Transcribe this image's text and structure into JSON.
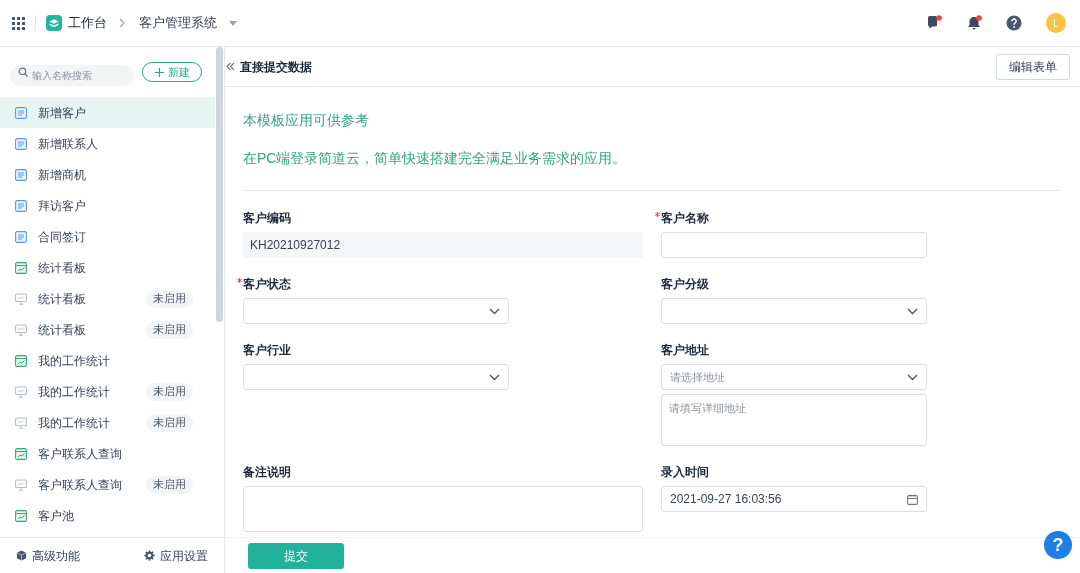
{
  "topbar": {
    "workspace": "工作台",
    "app": "客户管理系统",
    "actions": [
      {
        "kind": "chat",
        "unread": true
      },
      {
        "kind": "bell",
        "unread": true
      },
      {
        "kind": "help",
        "unread": false
      }
    ],
    "avatar": "L"
  },
  "sidebar": {
    "search": {
      "placeholder": "输入名称搜索"
    },
    "new_button": "新建",
    "items": [
      {
        "kind": "form",
        "label": "新增客户",
        "selected": true,
        "disabled": false
      },
      {
        "kind": "form",
        "label": "新增联系人",
        "selected": false,
        "disabled": false
      },
      {
        "kind": "form",
        "label": "新增商机",
        "selected": false,
        "disabled": false
      },
      {
        "kind": "form",
        "label": "拜访客户",
        "selected": false,
        "disabled": false
      },
      {
        "kind": "form",
        "label": "合同签订",
        "selected": false,
        "disabled": false
      },
      {
        "kind": "report",
        "label": "统计看板",
        "selected": false,
        "disabled": false
      },
      {
        "kind": "report",
        "label": "统计看板",
        "selected": false,
        "disabled": true,
        "badge": "未启用"
      },
      {
        "kind": "report",
        "label": "统计看板",
        "selected": false,
        "disabled": true,
        "badge": "未启用"
      },
      {
        "kind": "report",
        "label": "我的工作统计",
        "selected": false,
        "disabled": false
      },
      {
        "kind": "report",
        "label": "我的工作统计",
        "selected": false,
        "disabled": true,
        "badge": "未启用"
      },
      {
        "kind": "report",
        "label": "我的工作统计",
        "selected": false,
        "disabled": true,
        "badge": "未启用"
      },
      {
        "kind": "report",
        "label": "客户联系人查询",
        "selected": false,
        "disabled": false
      },
      {
        "kind": "report",
        "label": "客户联系人查询",
        "selected": false,
        "disabled": true,
        "badge": "未启用"
      },
      {
        "kind": "report",
        "label": "客户池",
        "selected": false,
        "disabled": false
      }
    ],
    "footer": [
      {
        "kind": "advanced",
        "label": "高级功能"
      },
      {
        "kind": "settings",
        "label": "应用设置"
      }
    ]
  },
  "main": {
    "title": "直接提交数据",
    "edit_button": "编辑表单",
    "intro": [
      "本模板应用可供参考",
      "在PC端登录简道云，简单快速搭建完全满足业务需求的应用。"
    ],
    "fields": [
      {
        "kind": "readonly",
        "label": "客户编码",
        "required": false,
        "value": "KH20210927012"
      },
      {
        "kind": "text",
        "label": "客户名称",
        "required": true
      },
      {
        "kind": "select",
        "label": "客户状态",
        "required": true
      },
      {
        "kind": "select",
        "label": "客户分级",
        "required": false
      },
      {
        "kind": "select",
        "label": "客户行业",
        "required": false
      },
      {
        "kind": "address",
        "label": "客户地址",
        "required": false,
        "placeholder": "请选择地址",
        "detail_placeholder": "请填写详细地址"
      },
      {
        "kind": "textarea",
        "label": "备注说明",
        "required": false
      },
      {
        "kind": "datetime",
        "label": "录入时间",
        "required": false,
        "value": "2021-09-27 16:03:56"
      }
    ],
    "submit": "提交"
  },
  "help_button": "?"
}
